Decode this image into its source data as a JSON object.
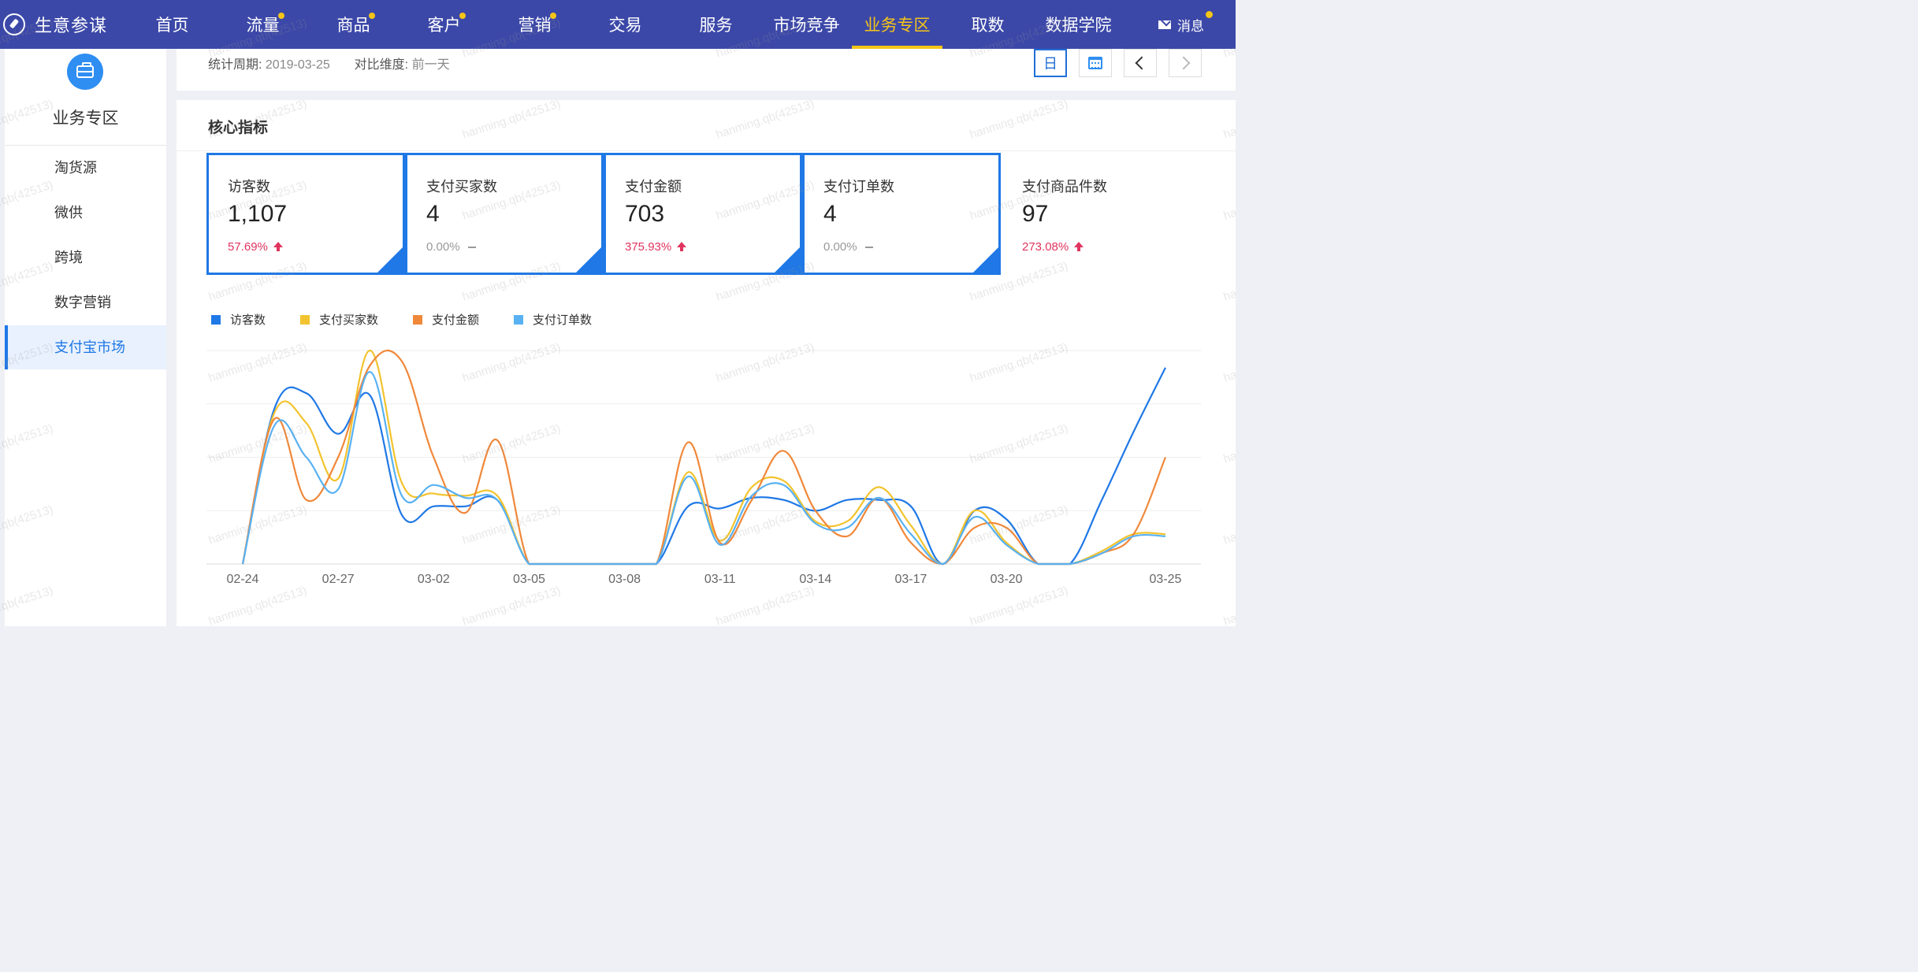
{
  "nav": {
    "brand": "生意参谋",
    "items": [
      {
        "label": "首页",
        "dot": false,
        "active": false
      },
      {
        "label": "流量",
        "dot": true,
        "active": false
      },
      {
        "label": "商品",
        "dot": true,
        "active": false
      },
      {
        "label": "客户",
        "dot": true,
        "active": false
      },
      {
        "label": "营销",
        "dot": true,
        "active": false
      },
      {
        "label": "交易",
        "dot": false,
        "active": false
      },
      {
        "label": "服务",
        "dot": false,
        "active": false
      },
      {
        "label": "市场竞争",
        "dot": false,
        "active": false
      },
      {
        "label": "业务专区",
        "dot": false,
        "active": true
      },
      {
        "label": "取数",
        "dot": false,
        "active": false
      },
      {
        "label": "数据学院",
        "dot": false,
        "active": false
      }
    ],
    "message_label": "消息"
  },
  "sidebar": {
    "title": "业务专区",
    "items": [
      {
        "label": "淘货源",
        "active": false
      },
      {
        "label": "微供",
        "active": false
      },
      {
        "label": "跨境",
        "active": false
      },
      {
        "label": "数字营销",
        "active": false
      },
      {
        "label": "支付宝市场",
        "active": true
      }
    ]
  },
  "period": {
    "label": "统计周期:",
    "value": "2019-03-25",
    "compare_label": "对比维度:",
    "compare_value": "前一天",
    "day_button": "日"
  },
  "core": {
    "title": "核心指标",
    "metrics": [
      {
        "label": "访客数",
        "value": "1,107",
        "change": "57.69%",
        "trend": "up",
        "selected": true
      },
      {
        "label": "支付买家数",
        "value": "4",
        "change": "0.00%",
        "trend": "flat",
        "selected": true
      },
      {
        "label": "支付金额",
        "value": "703",
        "change": "375.93%",
        "trend": "up",
        "selected": true
      },
      {
        "label": "支付订单数",
        "value": "4",
        "change": "0.00%",
        "trend": "flat",
        "selected": true
      },
      {
        "label": "支付商品件数",
        "value": "97",
        "change": "273.08%",
        "trend": "up",
        "selected": false
      }
    ]
  },
  "chart_data": {
    "type": "line",
    "x": [
      "02-24",
      "02-25",
      "02-26",
      "02-27",
      "02-28",
      "03-01",
      "03-02",
      "03-03",
      "03-04",
      "03-05",
      "03-06",
      "03-07",
      "03-08",
      "03-09",
      "03-10",
      "03-11",
      "03-12",
      "03-13",
      "03-14",
      "03-15",
      "03-16",
      "03-17",
      "03-18",
      "03-19",
      "03-20",
      "03-21",
      "03-22",
      "03-23",
      "03-24",
      "03-25"
    ],
    "tick_labels": [
      "02-24",
      "02-27",
      "03-02",
      "03-05",
      "03-08",
      "03-11",
      "03-14",
      "03-17",
      "03-20",
      "03-25"
    ],
    "ylim": [
      0,
      1
    ],
    "grid": true,
    "legend_position": "top-left",
    "series": [
      {
        "name": "访客数",
        "color": "#1f78e6",
        "values": [
          0,
          0.73,
          0.8,
          0.61,
          0.79,
          0.23,
          0.27,
          0.27,
          0.3,
          0,
          0,
          0,
          0,
          0,
          0.27,
          0.26,
          0.31,
          0.3,
          0.25,
          0.3,
          0.3,
          0.27,
          0,
          0.25,
          0.21,
          0,
          0,
          0.3,
          0.62,
          0.92
        ]
      },
      {
        "name": "支付买家数",
        "color": "#f2c32e",
        "values": [
          0,
          0.71,
          0.66,
          0.4,
          1.0,
          0.38,
          0.33,
          0.32,
          0.32,
          0,
          0,
          0,
          0,
          0,
          0.43,
          0.11,
          0.36,
          0.39,
          0.2,
          0.2,
          0.36,
          0.18,
          0,
          0.25,
          0.1,
          0,
          0,
          0.06,
          0.14,
          0.14
        ]
      },
      {
        "name": "支付金额",
        "color": "#f0883a",
        "values": [
          0,
          0.68,
          0.3,
          0.5,
          0.93,
          0.95,
          0.5,
          0.24,
          0.58,
          0,
          0,
          0,
          0,
          0,
          0.57,
          0.1,
          0.3,
          0.53,
          0.25,
          0.13,
          0.31,
          0.1,
          0,
          0.17,
          0.17,
          0,
          0,
          0.05,
          0.14,
          0.5
        ]
      },
      {
        "name": "支付订单数",
        "color": "#58b1f2",
        "values": [
          0,
          0.65,
          0.5,
          0.35,
          0.9,
          0.32,
          0.37,
          0.31,
          0.3,
          0,
          0,
          0,
          0,
          0,
          0.41,
          0.09,
          0.32,
          0.37,
          0.19,
          0.17,
          0.31,
          0.14,
          0,
          0.22,
          0.09,
          0,
          0,
          0.05,
          0.13,
          0.13
        ]
      }
    ]
  },
  "watermark": "hanming.qb(42513)"
}
